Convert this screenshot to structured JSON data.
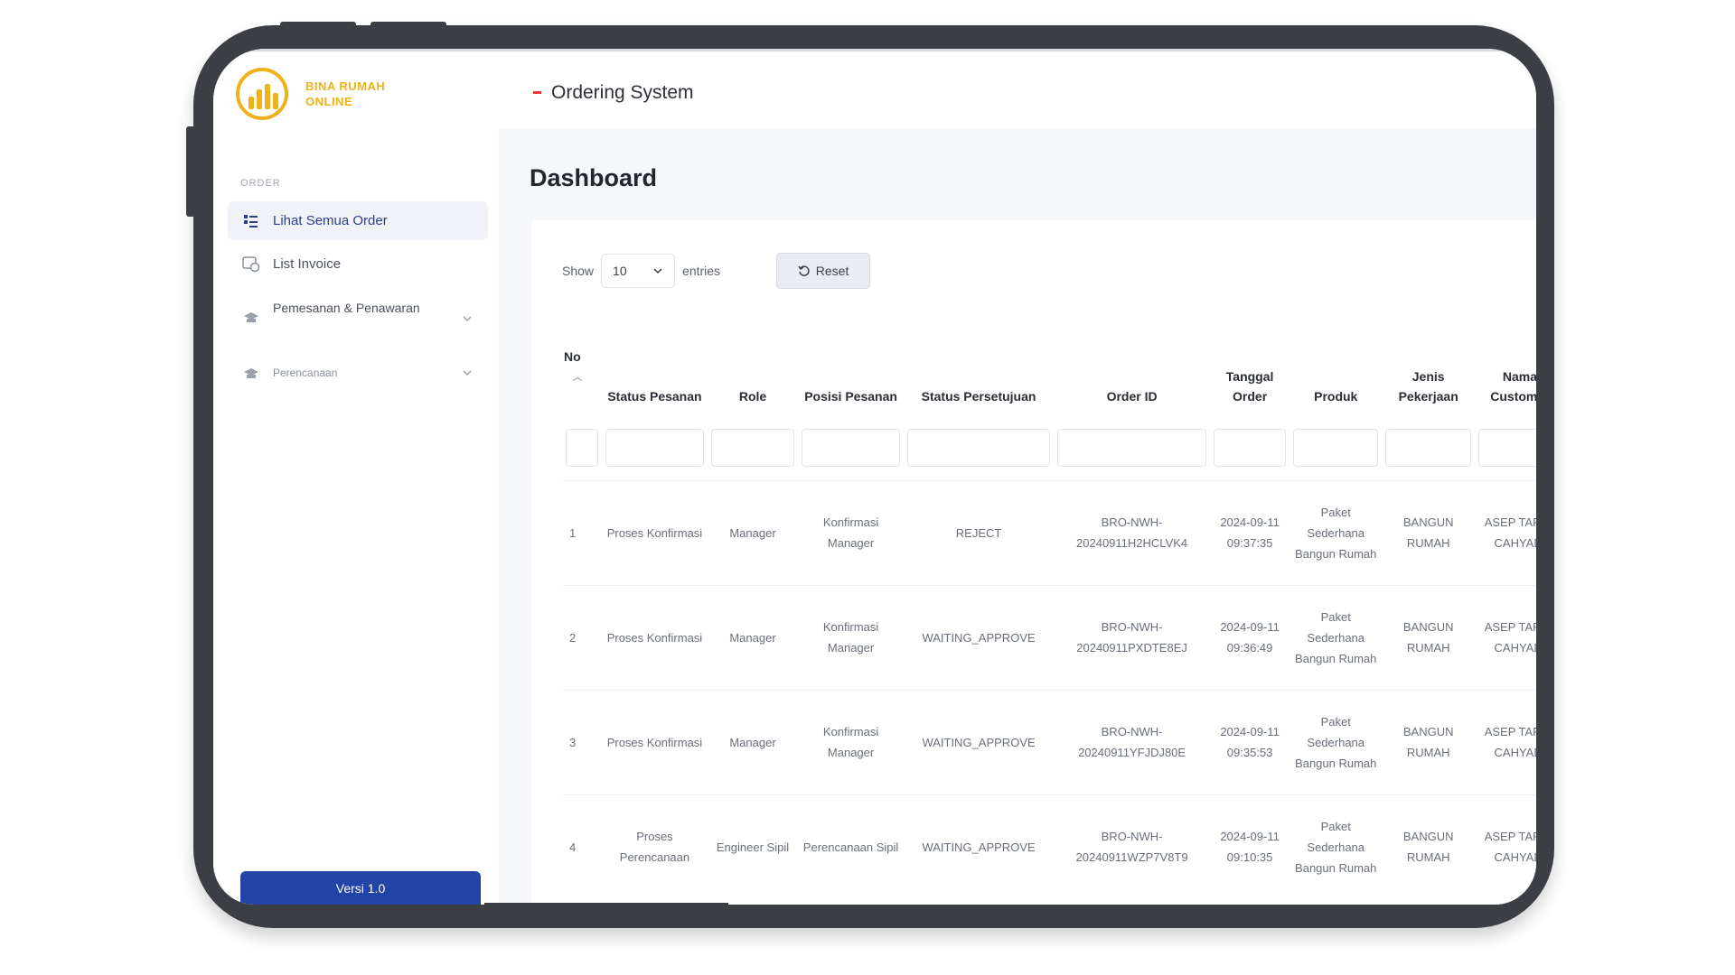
{
  "header": {
    "logo_line1": "BINA RUMAH",
    "logo_line2": "ONLINE",
    "title": "Ordering System"
  },
  "sidebar": {
    "section": "ORDER",
    "items": [
      {
        "label": "Lihat Semua Order",
        "icon": "list-order-icon"
      },
      {
        "label": "List Invoice",
        "icon": "invoice-icon"
      },
      {
        "label": "Pemesanan & Penawaran",
        "icon": "offer-icon"
      },
      {
        "label": "Perencanaan",
        "icon": "planning-icon"
      }
    ],
    "version": "Versi 1.0"
  },
  "main": {
    "title": "Dashboard",
    "show_label": "Show",
    "entries_value": "10",
    "entries_label": "entries",
    "reset_label": "Reset"
  },
  "table": {
    "columns": [
      "No",
      "Status Pesanan",
      "Role",
      "Posisi Pesanan",
      "Status Persetujuan",
      "Order ID",
      "Tanggal Order",
      "Produk",
      "Jenis Pekerjaan",
      "Nama Customer"
    ],
    "rows": [
      [
        "1",
        "Proses Konfirmasi",
        "Manager",
        "Konfirmasi Manager",
        "REJECT",
        "BRO-NWH-20240911H2HCLVK4",
        "2024-09-11 09:37:35",
        "Paket Sederhana Bangun Rumah",
        "BANGUN RUMAH",
        "ASEP TARAT CAHYADI"
      ],
      [
        "2",
        "Proses Konfirmasi",
        "Manager",
        "Konfirmasi Manager",
        "WAITING_APPROVE",
        "BRO-NWH-20240911PXDTE8EJ",
        "2024-09-11 09:36:49",
        "Paket Sederhana Bangun Rumah",
        "BANGUN RUMAH",
        "ASEP TARAT CAHYADI"
      ],
      [
        "3",
        "Proses Konfirmasi",
        "Manager",
        "Konfirmasi Manager",
        "WAITING_APPROVE",
        "BRO-NWH-20240911YFJDJ80E",
        "2024-09-11 09:35:53",
        "Paket Sederhana Bangun Rumah",
        "BANGUN RUMAH",
        "ASEP TARAT CAHYADI"
      ],
      [
        "4",
        "Proses Perencanaan",
        "Engineer Sipil",
        "Perencanaan Sipil",
        "WAITING_APPROVE",
        "BRO-NWH-20240911WZP7V8T9",
        "2024-09-11 09:10:35",
        "Paket Sederhana Bangun Rumah",
        "BANGUN RUMAH",
        "ASEP TARAT CAHYADI"
      ]
    ]
  },
  "colors": {
    "brand": "#f0b21b",
    "accent": "#2344a6",
    "alert": "#e53935"
  }
}
